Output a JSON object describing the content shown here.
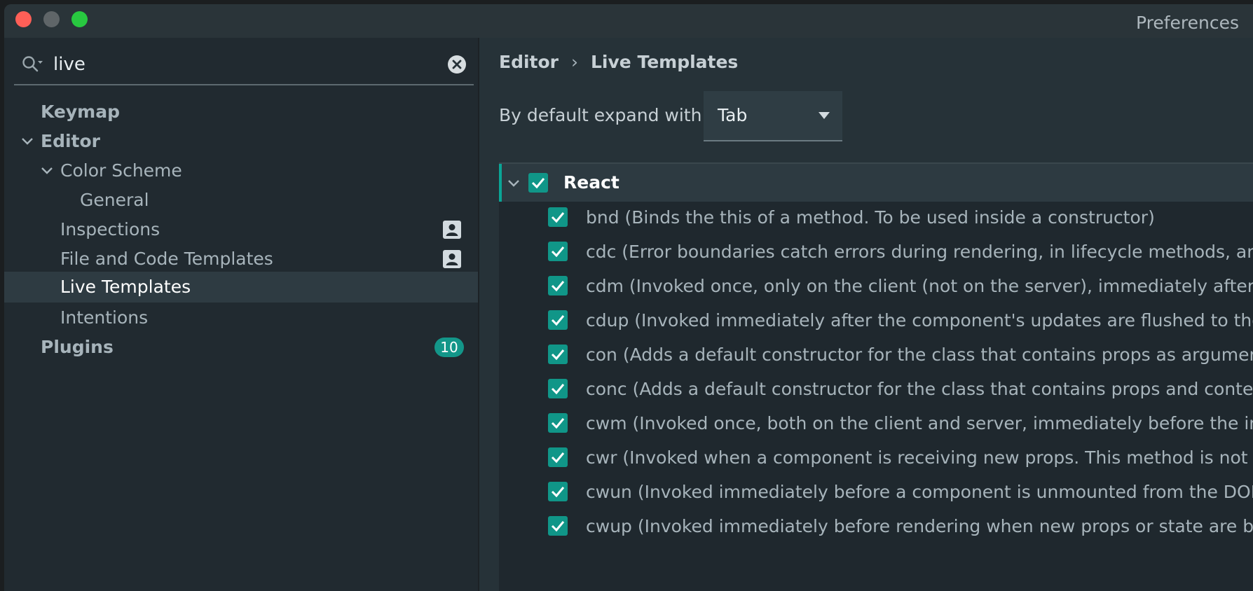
{
  "window": {
    "title": "Preferences"
  },
  "sidebar": {
    "search": {
      "value": "live",
      "placeholder": ""
    },
    "items": [
      {
        "label": "Keymap"
      },
      {
        "label": "Editor"
      },
      {
        "label": "Color Scheme"
      },
      {
        "label": "General"
      },
      {
        "label": "Inspections"
      },
      {
        "label": "File and Code Templates"
      },
      {
        "label": "Live Templates"
      },
      {
        "label": "Intentions"
      },
      {
        "label": "Plugins",
        "badge": "10"
      }
    ]
  },
  "main": {
    "breadcrumb": {
      "parent": "Editor",
      "separator": "›",
      "current": "Live Templates"
    },
    "expand": {
      "label": "By default expand with",
      "selected": "Tab"
    },
    "group": {
      "label": "React"
    },
    "templates": [
      {
        "text": "bnd (Binds the this of a method. To be used inside a constructor)"
      },
      {
        "text": "cdc (Error boundaries catch errors during rendering, in lifecycle methods, and"
      },
      {
        "text": "cdm (Invoked once, only on the client (not on the server), immediately after th"
      },
      {
        "text": "cdup (Invoked immediately after the component's updates are flushed to the D"
      },
      {
        "text": "con (Adds a default constructor for the class that contains props as argumen"
      },
      {
        "text": "conc (Adds a default constructor for the class that contains props and conte"
      },
      {
        "text": "cwm (Invoked once, both on the client and server, immediately before the initi"
      },
      {
        "text": "cwr (Invoked when a component is receiving new props. This method is not ca"
      },
      {
        "text": "cwun (Invoked immediately before a component is unmounted from the DOM."
      },
      {
        "text": "cwup (Invoked immediately before rendering when new props or state are bein"
      }
    ]
  },
  "colors": {
    "accent": "#109688",
    "selection": "#2e3b42"
  }
}
